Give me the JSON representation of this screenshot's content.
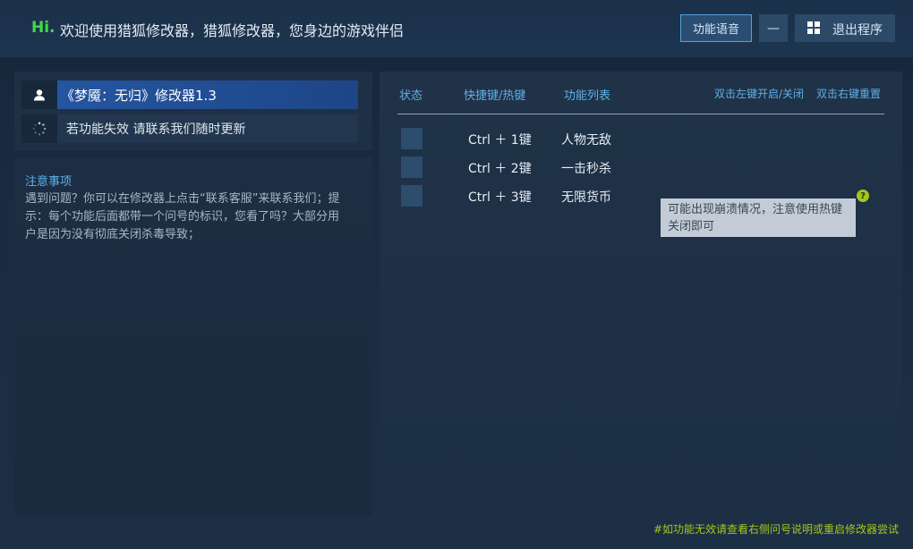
{
  "header": {
    "hi": "Hi.",
    "welcome": "欢迎使用猎狐修改器，猎狐修改器，您身边的游戏伴侣",
    "voice_button": "功能语音",
    "minimize_label": "—",
    "exit_button": "退出程序"
  },
  "left": {
    "game_title": "《梦魇：无归》修改器1.3",
    "support_text": "若功能失效  请联系我们随时更新",
    "notes_title": "注意事项",
    "notes_body": "遇到问题？你可以在修改器上点击“联系客服”来联系我们；提示：每个功能后面都带一个问号的标识，您看了吗？大部分用户是因为没有彻底关闭杀毒导致；"
  },
  "table": {
    "col_status": "状态",
    "col_hotkey": "快捷键/热键",
    "col_features": "功能列表",
    "action_toggle": "双击左键开启/关闭",
    "action_reset": "双击右键重置",
    "rows": [
      {
        "hotkey": "Ctrl ＋ 1键",
        "name": "人物无敌"
      },
      {
        "hotkey": "Ctrl ＋ 2键",
        "name": "一击秒杀"
      },
      {
        "hotkey": "Ctrl ＋ 3键",
        "name": "无限货币"
      }
    ]
  },
  "tooltip": {
    "help_icon_text": "?",
    "text": "可能出现崩溃情况，注意使用热键关闭即可"
  },
  "footer": {
    "note": "#如功能无效请查看右侧问号说明或重启修改器尝试"
  },
  "colors": {
    "accent_blue": "#5fb0e8",
    "hi_green": "#3ddc4a",
    "help_green": "#a4c71a",
    "selected_row": "#2555a0"
  }
}
